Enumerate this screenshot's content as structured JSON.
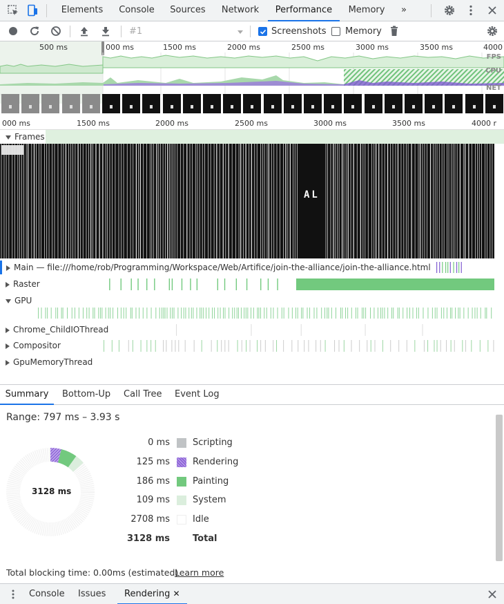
{
  "topbar": {
    "tabs": [
      "Elements",
      "Console",
      "Sources",
      "Network",
      "Performance",
      "Memory"
    ],
    "overflow": "»",
    "active_tab": "Performance",
    "icons": [
      "inspect-icon",
      "device-toolbar-icon",
      "gear-icon",
      "more-vert-icon",
      "close-icon"
    ]
  },
  "toolbar": {
    "profile_select": "#1",
    "screenshots_label": "Screenshots",
    "screenshots_checked": true,
    "memory_label": "Memory",
    "memory_checked": false,
    "icons": [
      "record-icon",
      "reload-icon",
      "clear-icon",
      "upload-icon",
      "download-icon",
      "dropdown-icon",
      "trash-icon",
      "gear-icon"
    ]
  },
  "overview": {
    "ruler": [
      "500 ms",
      "000 ms",
      "1500 ms",
      "2000 ms",
      "2500 ms",
      "3000 ms",
      "3500 ms",
      "4000"
    ],
    "lanes": [
      "FPS",
      "CPU",
      "NET"
    ]
  },
  "timeline": {
    "ruler": [
      "000 ms",
      "1500 ms",
      "2000 ms",
      "2500 ms",
      "3000 ms",
      "3500 ms",
      "4000 r"
    ],
    "frames_label": "Frames",
    "frame_text": "AL",
    "tracks": [
      {
        "label": "Main — file:///home/rob/Programming/Workspace/Web/Artifice/join-the-alliance/join-the-alliance.html",
        "expanded": false
      },
      {
        "label": "Raster",
        "expanded": false
      },
      {
        "label": "GPU",
        "expanded": true
      },
      {
        "label": "Chrome_ChildIOThread",
        "expanded": false
      },
      {
        "label": "Compositor",
        "expanded": false
      },
      {
        "label": "GpuMemoryThread",
        "expanded": false
      }
    ]
  },
  "details": {
    "tabs": [
      "Summary",
      "Bottom-Up",
      "Call Tree",
      "Event Log"
    ],
    "active_tab": "Summary",
    "range": "Range: 797 ms – 3.93 s",
    "total_center": "3128 ms",
    "legend": [
      {
        "value": "0 ms",
        "label": "Scripting",
        "color": "#c0c3c5"
      },
      {
        "value": "125 ms",
        "label": "Rendering",
        "color": "#8e64d8"
      },
      {
        "value": "186 ms",
        "label": "Painting",
        "color": "#72c97e"
      },
      {
        "value": "109 ms",
        "label": "System",
        "color": "#dbeedd"
      },
      {
        "value": "2708 ms",
        "label": "Idle",
        "color": "#ffffff"
      },
      {
        "value": "3128 ms",
        "label": "Total",
        "color": ""
      }
    ],
    "blocking_time": "Total blocking time: 0.00ms (estimated)",
    "learn_more": "Learn more"
  },
  "drawer": {
    "tabs": [
      "Console",
      "Issues",
      "Rendering"
    ],
    "active_tab": "Rendering",
    "close_tab": "✕",
    "icons": [
      "drawer-menu-icon",
      "close-icon"
    ]
  }
}
